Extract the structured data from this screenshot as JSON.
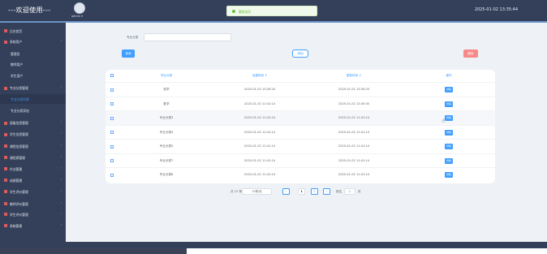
{
  "header": {
    "brand": "---欢迎使用---",
    "user_name": "admin ▾",
    "datetime": "2025-01-02 13:35:44"
  },
  "toast": {
    "message": "删除成功"
  },
  "sidebar": {
    "items": [
      {
        "label": "后台首页",
        "type": "top"
      },
      {
        "label": "系统用户",
        "type": "group",
        "expanded": true
      },
      {
        "label": "管理员",
        "type": "sub"
      },
      {
        "label": "教师用户",
        "type": "sub"
      },
      {
        "label": "学生用户",
        "type": "sub"
      },
      {
        "label": "专业分类管理",
        "type": "group",
        "expanded": true
      },
      {
        "label": "专业分类列表",
        "type": "sub",
        "active": true
      },
      {
        "label": "专业分类添加",
        "type": "sub"
      },
      {
        "label": "班级信息管理",
        "type": "group"
      },
      {
        "label": "学生信息管理",
        "type": "group"
      },
      {
        "label": "课程信息管理",
        "type": "group"
      },
      {
        "label": "课程表管理",
        "type": "group"
      },
      {
        "label": "作业管理",
        "type": "group"
      },
      {
        "label": "成绩管理",
        "type": "group"
      },
      {
        "label": "学生评价管理",
        "type": "group"
      },
      {
        "label": "教师评价管理",
        "type": "group"
      },
      {
        "label": "学生评价管理",
        "type": "group"
      },
      {
        "label": "系统管理",
        "type": "group"
      }
    ]
  },
  "search": {
    "label": "专业分类",
    "value": "",
    "placeholder": "",
    "query_button": "查询",
    "add_button": "添加",
    "delete_button": "删除"
  },
  "table": {
    "columns": [
      "专业分类",
      "创建时间 ↕",
      "更新时间 ↕",
      "操作"
    ],
    "action_label": "详情",
    "rows": [
      {
        "name": "哲学",
        "created": "2025-01-02 13:35:20",
        "updated": "2025-01-02 13:35:20"
      },
      {
        "name": "数学",
        "created": "2025-01-02 11:41:14",
        "updated": "2025-01-02 13:35:35"
      },
      {
        "name": "专业分类3",
        "created": "2025-01-02 11:41:14",
        "updated": "2025-01-02 11:41:14"
      },
      {
        "name": "专业分类4",
        "created": "2025-01-02 11:41:14",
        "updated": "2025-01-02 11:41:14"
      },
      {
        "name": "专业分类5",
        "created": "2025-01-02 11:41:14",
        "updated": "2025-01-02 11:41:14"
      },
      {
        "name": "专业分类7",
        "created": "2025-01-02 11:41:14",
        "updated": "2025-01-02 11:41:14"
      },
      {
        "name": "专业分类8",
        "created": "2025-01-02 11:41:14",
        "updated": "2025-01-02 11:41:14"
      }
    ]
  },
  "pagination": {
    "total_text": "共 12 条",
    "page_size": "10条/页",
    "prev": "‹",
    "pages": [
      "1",
      "2"
    ],
    "current_page": "1",
    "next": "›",
    "goto_prefix": "前往",
    "goto_value": "1",
    "goto_suffix": "页"
  },
  "colors": {
    "sidebar_bg": "#34405a",
    "accent": "#409eff",
    "danger": "#f78989",
    "success": "#67c23a"
  }
}
